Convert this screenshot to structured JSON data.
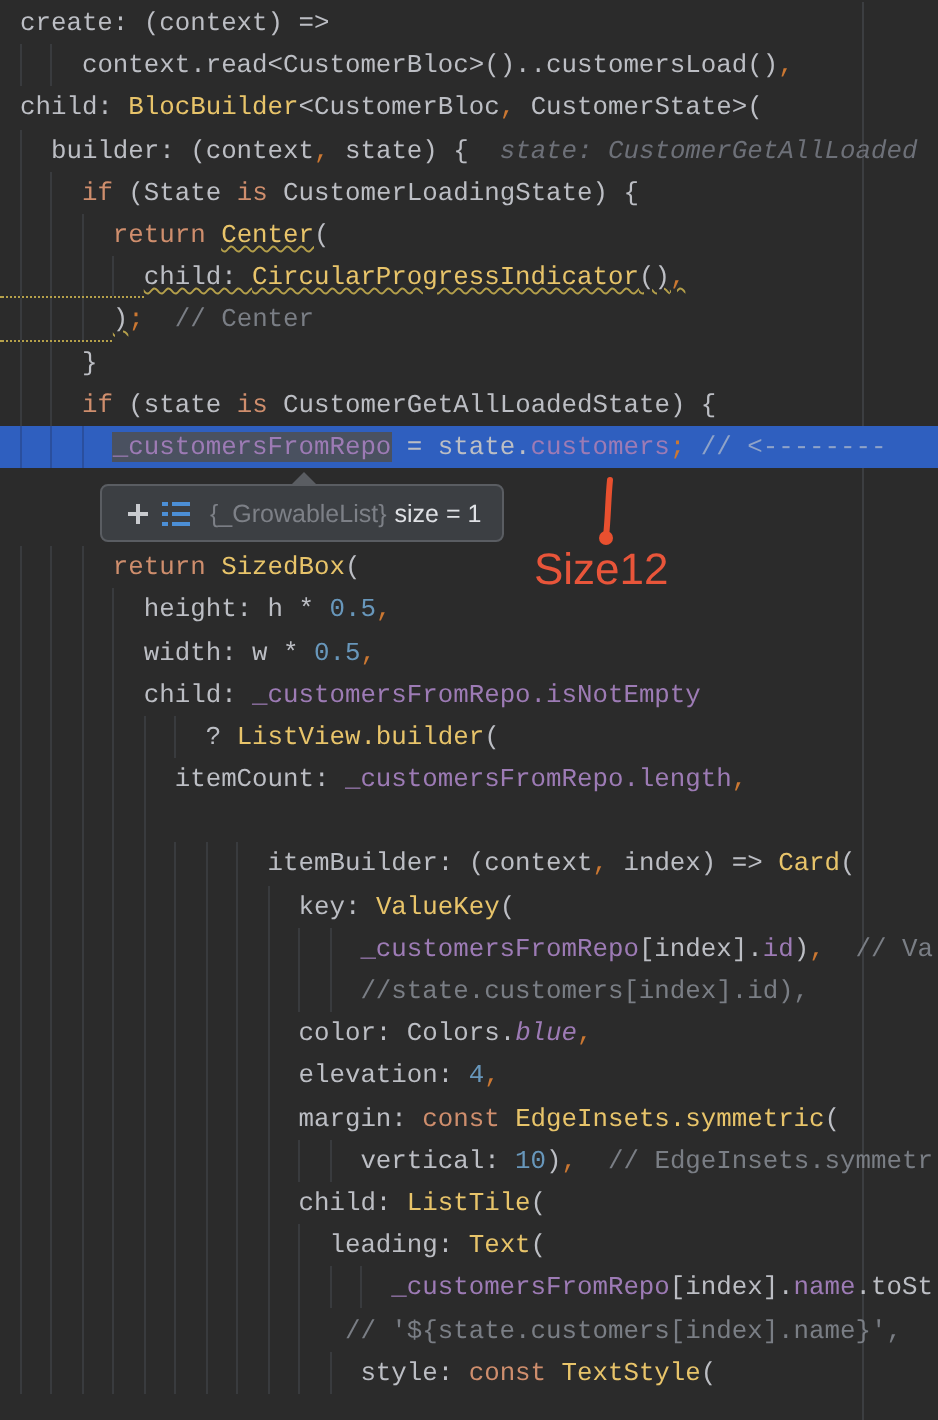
{
  "editor": {
    "code_top": [
      {
        "kind": "code",
        "tokens": [
          {
            "kind": "plain",
            "text": "create: (context) =>"
          }
        ]
      },
      {
        "kind": "code",
        "tokens": [
          {
            "kind": "plain",
            "text": "    context.read<CustomerBloc>()..customersLoad()"
          },
          {
            "kind": "punct",
            "text": ","
          }
        ]
      },
      {
        "kind": "code",
        "tokens": [
          {
            "kind": "plain",
            "text": "child: "
          },
          {
            "kind": "cls",
            "text": "BlocBuilder"
          },
          {
            "kind": "plain",
            "text": "<CustomerBloc"
          },
          {
            "kind": "punct",
            "text": ", "
          },
          {
            "kind": "plain",
            "text": "CustomerState>("
          }
        ]
      },
      {
        "kind": "code",
        "tokens": [
          {
            "kind": "plain",
            "text": "  builder: (context"
          },
          {
            "kind": "punct",
            "text": ", "
          },
          {
            "kind": "plain",
            "text": "state) {"
          },
          {
            "kind": "hint",
            "text": "  state: CustomerGetAllLoaded"
          }
        ]
      },
      {
        "kind": "code",
        "tokens": [
          {
            "kind": "kw",
            "text": "    if"
          },
          {
            "kind": "plain",
            "text": " (State "
          },
          {
            "kind": "kw",
            "text": "is"
          },
          {
            "kind": "plain",
            "text": " CustomerLoadingState) {"
          }
        ]
      },
      {
        "kind": "code",
        "tokens": [
          {
            "kind": "kw",
            "text": "      return "
          },
          {
            "kind": "cls",
            "text": "Center",
            "warning": true
          },
          {
            "kind": "plain",
            "text": "("
          }
        ]
      },
      {
        "kind": "code",
        "warning": true,
        "tokens": [
          {
            "kind": "plain",
            "text": "        child: ",
            "warning": true
          },
          {
            "kind": "cls",
            "text": "CircularProgressIndicator",
            "warning": true
          },
          {
            "kind": "plain",
            "text": "()",
            "warning": true
          },
          {
            "kind": "punct",
            "text": ",",
            "warning": true
          }
        ]
      },
      {
        "kind": "code",
        "warning": true,
        "tokens": [
          {
            "kind": "plain",
            "text": "      )",
            "warning": true
          },
          {
            "kind": "punct",
            "text": ";"
          },
          {
            "kind": "comment",
            "text": "  // Center"
          }
        ]
      },
      {
        "kind": "code",
        "tokens": [
          {
            "kind": "plain",
            "text": "    }"
          }
        ]
      },
      {
        "kind": "code",
        "tokens": [
          {
            "kind": "kw",
            "text": "    if"
          },
          {
            "kind": "plain",
            "text": " (state "
          },
          {
            "kind": "kw",
            "text": "is"
          },
          {
            "kind": "plain",
            "text": " CustomerGetAllLoadedState) {"
          }
        ]
      },
      {
        "kind": "code",
        "current": true,
        "tokens": [
          {
            "kind": "field",
            "text": "      _customersFromRepo",
            "hovered": true
          },
          {
            "kind": "plain",
            "text": " = state."
          },
          {
            "kind": "field",
            "text": "customers"
          },
          {
            "kind": "punct",
            "text": ";"
          },
          {
            "kind": "comment",
            "text": " // <--------"
          }
        ]
      }
    ],
    "debug_popup": {
      "type": "{_GrowableList}",
      "value": "size = 1"
    },
    "annotation": {
      "text": "Size12"
    },
    "code_bottom": [
      {
        "kind": "code",
        "tokens": [
          {
            "kind": "kw",
            "text": "      return "
          },
          {
            "kind": "cls",
            "text": "SizedBox"
          },
          {
            "kind": "plain",
            "text": "("
          }
        ]
      },
      {
        "kind": "code",
        "tokens": [
          {
            "kind": "plain",
            "text": "        height: h * "
          },
          {
            "kind": "num",
            "text": "0.5"
          },
          {
            "kind": "punct",
            "text": ","
          }
        ]
      },
      {
        "kind": "code",
        "tokens": [
          {
            "kind": "plain",
            "text": "        width: w * "
          },
          {
            "kind": "num",
            "text": "0.5"
          },
          {
            "kind": "punct",
            "text": ","
          }
        ]
      },
      {
        "kind": "code",
        "tokens": [
          {
            "kind": "plain",
            "text": "        child: "
          },
          {
            "kind": "field",
            "text": "_customersFromRepo.isNotEmpty"
          }
        ]
      },
      {
        "kind": "code",
        "tokens": [
          {
            "kind": "plain",
            "text": "            ? "
          },
          {
            "kind": "cls",
            "text": "ListView.builder"
          },
          {
            "kind": "plain",
            "text": "("
          }
        ]
      },
      {
        "kind": "code",
        "tokens": [
          {
            "kind": "plain",
            "text": "          itemCount: "
          },
          {
            "kind": "field",
            "text": "_customersFromRepo.length"
          },
          {
            "kind": "punct",
            "text": ","
          }
        ]
      },
      {
        "kind": "blank"
      },
      {
        "kind": "code",
        "tokens": [
          {
            "kind": "plain",
            "text": "                itemBuilder: (context"
          },
          {
            "kind": "punct",
            "text": ", "
          },
          {
            "kind": "plain",
            "text": "index) => "
          },
          {
            "kind": "cls",
            "text": "Card"
          },
          {
            "kind": "plain",
            "text": "("
          }
        ]
      },
      {
        "kind": "code",
        "tokens": [
          {
            "kind": "plain",
            "text": "                  key: "
          },
          {
            "kind": "cls",
            "text": "ValueKey"
          },
          {
            "kind": "plain",
            "text": "("
          }
        ]
      },
      {
        "kind": "code",
        "tokens": [
          {
            "kind": "field",
            "text": "                      _customersFromRepo"
          },
          {
            "kind": "plain",
            "text": "[index]."
          },
          {
            "kind": "field",
            "text": "id"
          },
          {
            "kind": "plain",
            "text": ")"
          },
          {
            "kind": "punct",
            "text": ","
          },
          {
            "kind": "comment",
            "text": "  // Va"
          }
        ]
      },
      {
        "kind": "code",
        "tokens": [
          {
            "kind": "comment",
            "text": "                      //state.customers[index].id),"
          }
        ]
      },
      {
        "kind": "code",
        "tokens": [
          {
            "kind": "plain",
            "text": "                  color: Colors."
          },
          {
            "kind": "static",
            "text": "blue"
          },
          {
            "kind": "punct",
            "text": ","
          }
        ]
      },
      {
        "kind": "code",
        "tokens": [
          {
            "kind": "plain",
            "text": "                  elevation: "
          },
          {
            "kind": "num",
            "text": "4"
          },
          {
            "kind": "punct",
            "text": ","
          }
        ]
      },
      {
        "kind": "code",
        "tokens": [
          {
            "kind": "plain",
            "text": "                  margin: "
          },
          {
            "kind": "kw",
            "text": "const "
          },
          {
            "kind": "cls",
            "text": "EdgeInsets.symmetric"
          },
          {
            "kind": "plain",
            "text": "("
          }
        ]
      },
      {
        "kind": "code",
        "tokens": [
          {
            "kind": "plain",
            "text": "                      vertical: "
          },
          {
            "kind": "num",
            "text": "10"
          },
          {
            "kind": "plain",
            "text": ")"
          },
          {
            "kind": "punct",
            "text": ","
          },
          {
            "kind": "comment",
            "text": "  // EdgeInsets.symmetr"
          }
        ]
      },
      {
        "kind": "code",
        "tokens": [
          {
            "kind": "plain",
            "text": "                  child: "
          },
          {
            "kind": "cls",
            "text": "ListTile"
          },
          {
            "kind": "plain",
            "text": "("
          }
        ]
      },
      {
        "kind": "code",
        "tokens": [
          {
            "kind": "plain",
            "text": "                    leading: "
          },
          {
            "kind": "cls",
            "text": "Text"
          },
          {
            "kind": "plain",
            "text": "("
          }
        ]
      },
      {
        "kind": "code",
        "tokens": [
          {
            "kind": "field",
            "text": "                        _customersFromRepo"
          },
          {
            "kind": "plain",
            "text": "[index]."
          },
          {
            "kind": "field",
            "text": "name"
          },
          {
            "kind": "plain",
            "text": ".toSt"
          }
        ]
      },
      {
        "kind": "code",
        "tokens": [
          {
            "kind": "comment",
            "text": "                     // '${state.customers[index].name}',"
          }
        ]
      },
      {
        "kind": "code",
        "tokens": [
          {
            "kind": "plain",
            "text": "                      style: "
          },
          {
            "kind": "kw",
            "text": "const "
          },
          {
            "kind": "cls",
            "text": "TextStyle"
          },
          {
            "kind": "plain",
            "text": "("
          }
        ]
      }
    ]
  }
}
